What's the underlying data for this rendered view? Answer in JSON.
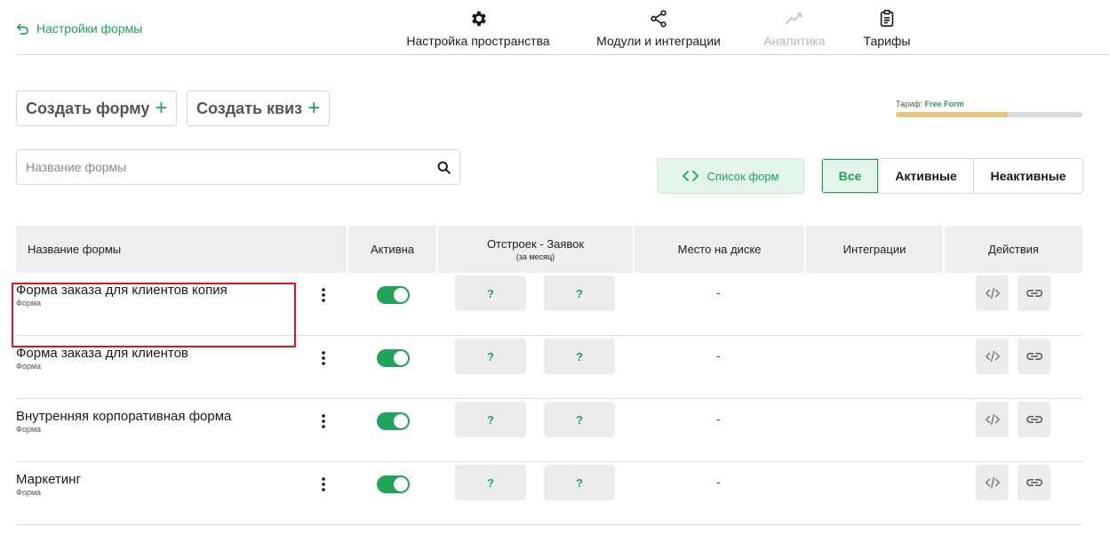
{
  "header": {
    "back_label": "Настройки формы",
    "nav": [
      {
        "label": "Настройка пространства",
        "icon": "gear-icon"
      },
      {
        "label": "Модули и интеграции",
        "icon": "share-icon"
      },
      {
        "label": "Аналитика",
        "icon": "analytics-icon",
        "disabled": true
      },
      {
        "label": "Тарифы",
        "icon": "clipboard-icon"
      }
    ]
  },
  "actions": {
    "create_form": "Создать форму",
    "create_quiz": "Создать квиз"
  },
  "tariff": {
    "label": "Тариф:",
    "plan": "Free Form",
    "usage_fraction": 0.6
  },
  "search": {
    "placeholder": "Название формы",
    "value": ""
  },
  "list_button": "Список форм",
  "filters": [
    "Все",
    "Активные",
    "Неактивные"
  ],
  "active_filter": 0,
  "table": {
    "columns": {
      "name": "Название формы",
      "active": "Активна",
      "builds": "Отстроек - Заявок",
      "builds_sub": "(за месяц)",
      "disk": "Место на диске",
      "integrations": "Интеграции",
      "actions": "Действия"
    },
    "rows": [
      {
        "name": "Форма заказа для клиентов копия",
        "type": "Форма",
        "active": true,
        "builds": "?",
        "requests": "?",
        "disk": "-"
      },
      {
        "name": "Форма заказа для клиентов",
        "type": "Форма",
        "active": true,
        "builds": "?",
        "requests": "?",
        "disk": "-"
      },
      {
        "name": "Внутренняя корпоративная форма",
        "type": "Форма",
        "active": true,
        "builds": "?",
        "requests": "?",
        "disk": "-"
      },
      {
        "name": "Маркетинг",
        "type": "Форма",
        "active": true,
        "builds": "?",
        "requests": "?",
        "disk": "-"
      }
    ]
  },
  "colors": {
    "accent": "#21a35a",
    "accent_bg": "#e3f4e9",
    "highlight": "#e2141a",
    "tariff_fill": "#e6c57e"
  }
}
